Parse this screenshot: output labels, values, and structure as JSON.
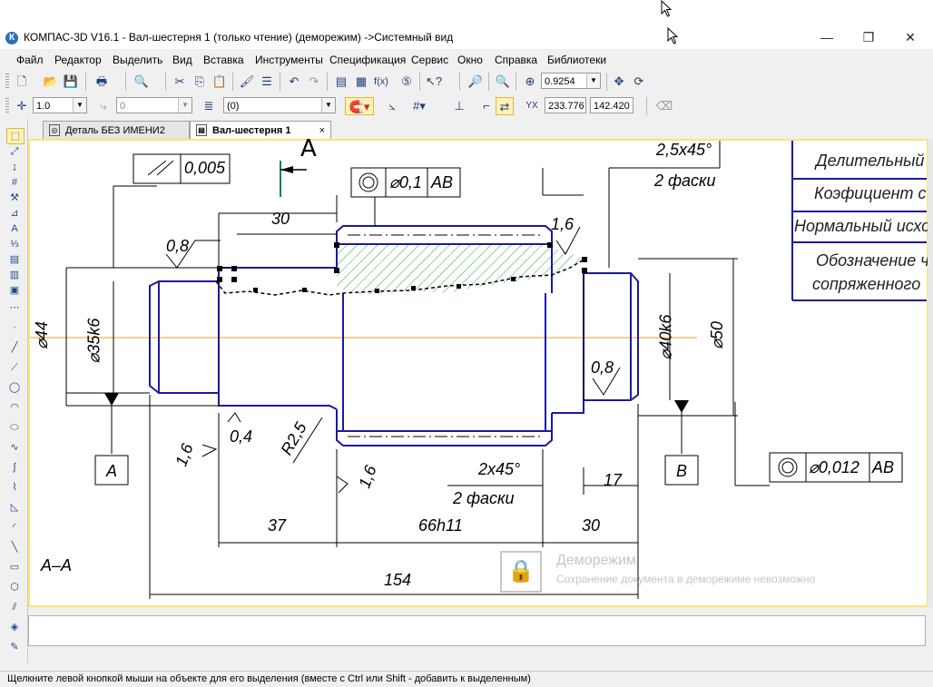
{
  "window": {
    "title": "КОМПАС-3D V16.1 - Вал-шестерня 1 (только чтение) (деморежим) ->Системный вид",
    "app_icon": "kompas-logo-icon",
    "controls": [
      "—",
      "❐",
      "✕"
    ]
  },
  "menu": [
    "Файл",
    "Редактор",
    "Выделить",
    "Вид",
    "Вставка",
    "Инструменты",
    "Спецификация",
    "Сервис",
    "Окно",
    "Справка",
    "Библиотеки"
  ],
  "toolbar1": {
    "zoom_value": "0.9254"
  },
  "toolbar2": {
    "line_scale": "1.0",
    "angle_value": "0",
    "layer": "(0)",
    "coord_x": "233.776",
    "coord_y": "142.420",
    "coord_label_y": "Y",
    "coord_label_x": "X"
  },
  "tabs": [
    {
      "label": "Деталь БЕЗ ИМЕНИ2",
      "icon": "part-icon",
      "active": false
    },
    {
      "label": "Вал-шестерня 1",
      "icon": "drawing-icon",
      "active": true,
      "close": "×"
    }
  ],
  "drawing": {
    "view_label": "A",
    "section_label": "А–А",
    "tol_runout_value": "0,005",
    "tol_concentric_value": "⌀0,1",
    "tol_concentric_base": "АВ",
    "tol_right_value": "⌀0,012",
    "tol_right_base": "АВ",
    "datum_a": "А",
    "datum_b": "В",
    "dim_30_top": "30",
    "rough_08_left": "0,8",
    "rough_16_top": "1,6",
    "rough_08_right": "0,8",
    "rough_04": "0,4",
    "rough_16_left": "1,6",
    "rough_16_mid": "1,6",
    "radius": "R2,5",
    "chamfer_top": "2,5х45°",
    "chamfer_top_count": "2 фаски",
    "chamfer_bottom": "2х45°",
    "chamfer_bottom_count": "2 фаски",
    "dia_44": "⌀44",
    "dia_35": "⌀35k6",
    "dia_40": "⌀40k6",
    "dia_50": "⌀50",
    "dim_17": "17",
    "dim_37": "37",
    "dim_66": "66h11",
    "dim_30_bottom": "30",
    "dim_154": "154",
    "table_rows": [
      "Делительный",
      "Коэфициент с",
      "Нормальный исход",
      "Обозначение ч",
      "сопряженного"
    ]
  },
  "watermark": {
    "title": "Деморежим",
    "subtitle": "Сохранение документа в деморежиме невозможно"
  },
  "status": "Щелкните левой кнопкой мыши на объекте для его выделения (вместе с Ctrl или Shift - добавить к выделенным)",
  "colors": {
    "contour": "#1a1aa0",
    "hatch": "#2ea043",
    "axis": "#e8a020",
    "frame_highlight": "#ffe27a"
  }
}
